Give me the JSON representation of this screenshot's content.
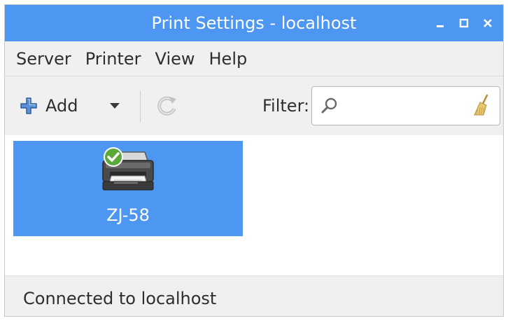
{
  "window": {
    "title": "Print Settings - localhost"
  },
  "menu": {
    "items": [
      {
        "label": "Server"
      },
      {
        "label": "Printer"
      },
      {
        "label": "View"
      },
      {
        "label": "Help"
      }
    ]
  },
  "toolbar": {
    "add_label": "Add",
    "filter_label": "Filter:",
    "filter_value": ""
  },
  "printers": [
    {
      "name": "ZJ-58",
      "status": "default",
      "selected": true
    }
  ],
  "status": {
    "text": "Connected to localhost"
  },
  "colors": {
    "accent": "#4d97f2",
    "chrome": "#f0f0f0",
    "text": "#2e2e2e"
  },
  "icons": {
    "minimize": "minimize-icon",
    "maximize": "maximize-icon",
    "close": "close-icon",
    "add": "plus-icon",
    "dropdown": "chevron-down-icon",
    "refresh": "refresh-icon",
    "search": "search-icon",
    "clear": "broom-clear-icon",
    "printer": "printer-icon",
    "check": "check-badge-icon"
  }
}
